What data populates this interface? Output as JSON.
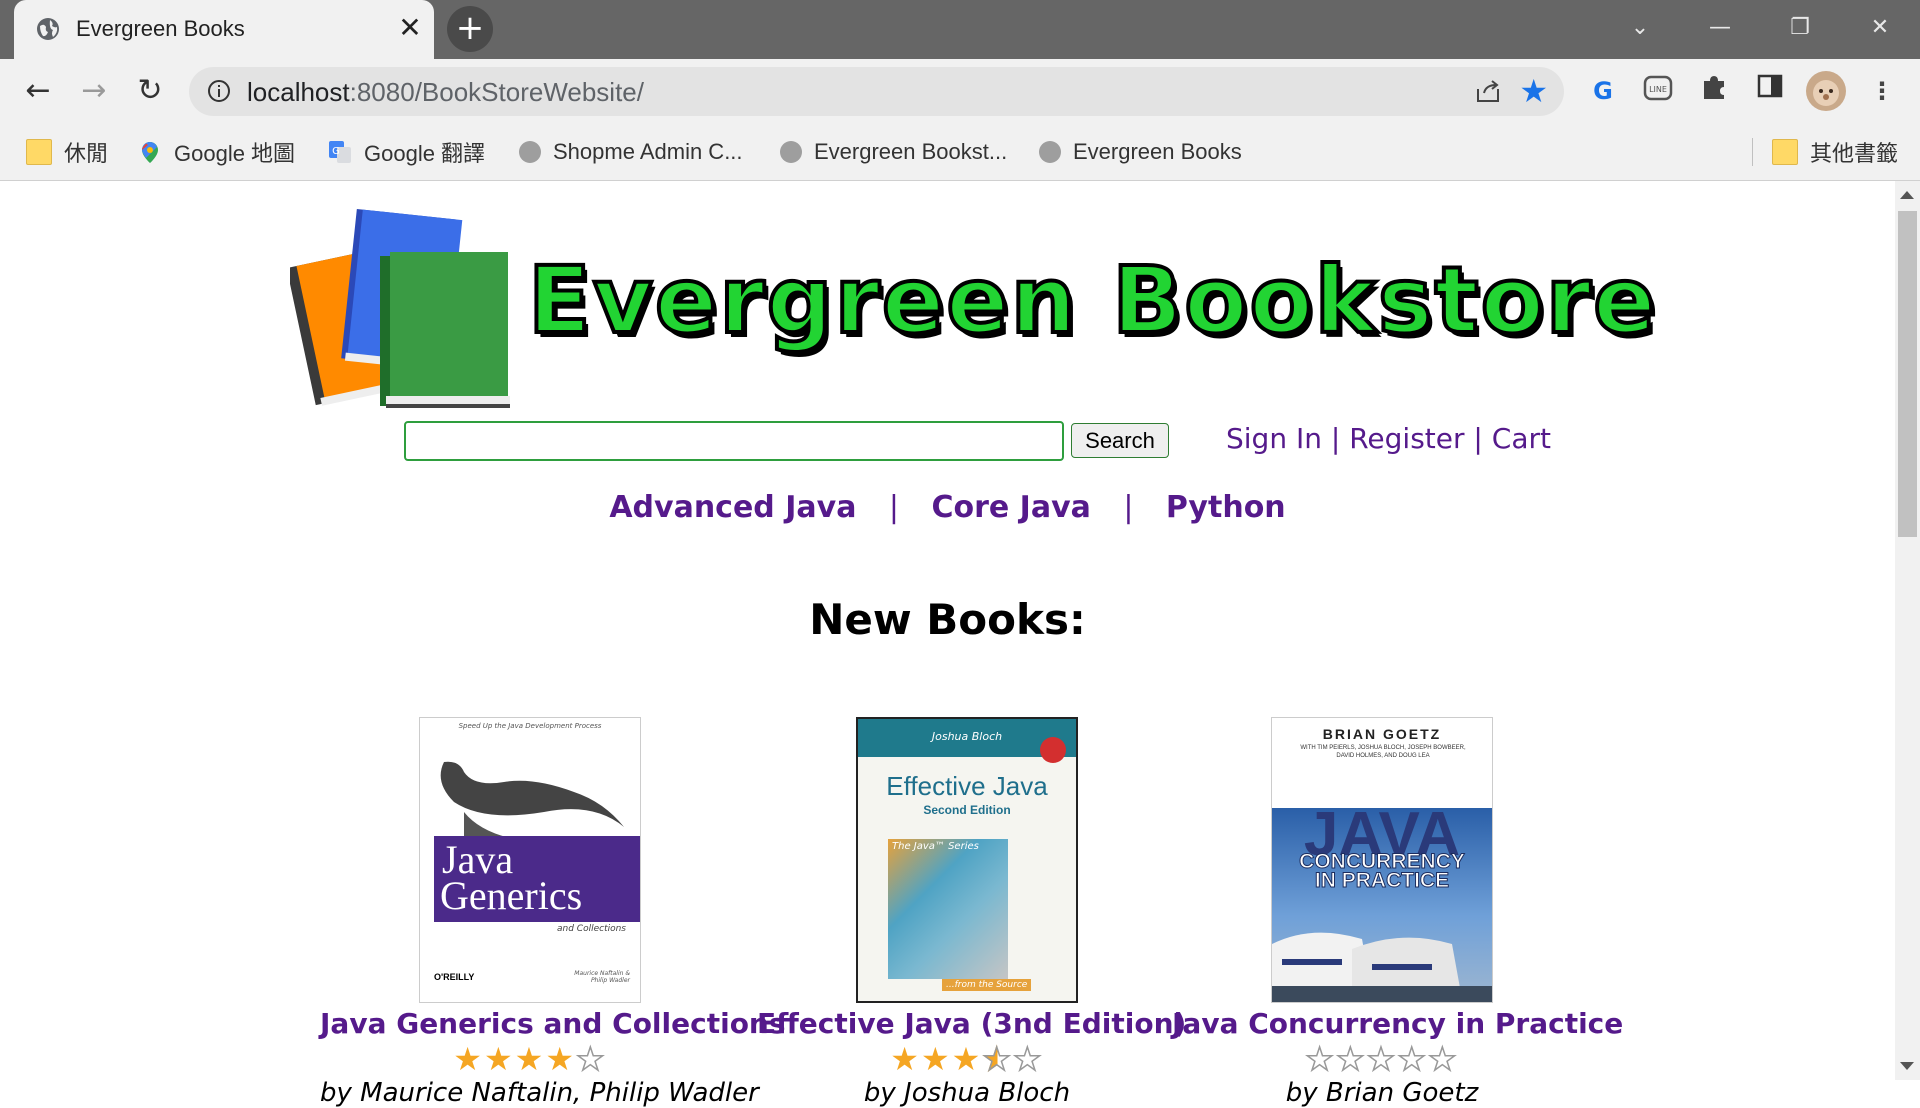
{
  "browser": {
    "tab_title": "Evergreen Books",
    "url_host": "localhost",
    "url_rest": ":8080/BookStoreWebsite/",
    "bookmarks": [
      {
        "label": "休閒",
        "icon": "folder-icon"
      },
      {
        "label": "Google 地圖",
        "icon": "google-maps-icon"
      },
      {
        "label": "Google 翻譯",
        "icon": "google-translate-icon"
      },
      {
        "label": "Shopme Admin C...",
        "icon": "globe-icon"
      },
      {
        "label": "Evergreen Bookst...",
        "icon": "globe-icon"
      },
      {
        "label": "Evergreen Books",
        "icon": "globe-icon"
      }
    ],
    "other_bookmarks": "其他書籤"
  },
  "header": {
    "logo_text": "Evergreen Bookstore",
    "search_button": "Search",
    "search_value": "",
    "sign_in": "Sign In",
    "register": "Register",
    "cart": "Cart",
    "separator": "|"
  },
  "categories": [
    "Advanced Java",
    "Core Java",
    "Python"
  ],
  "section_title": "New Books:",
  "books": [
    {
      "title": "Java Generics and Collections",
      "rating": 4,
      "author": "by Maurice Naftalin, Philip Wadler"
    },
    {
      "title": "Effective Java (3nd Edition)",
      "rating": 3.5,
      "author": "by Joshua Bloch"
    },
    {
      "title": "Java Concurrency in Practice",
      "rating": 0,
      "author": "by Brian Goetz"
    }
  ],
  "covers": {
    "generics": {
      "top": "Speed Up the Java Development Process",
      "line1": "Java",
      "line2": "Generics",
      "sub": "and Collections",
      "publisher": "O'REILLY",
      "authors": "Maurice Naftalin & Philip Wadler"
    },
    "effective": {
      "author": "Joshua Bloch",
      "title": "Effective Java",
      "edition": "Second Edition",
      "series": "The Java™ Series",
      "footer": "...from the Source"
    },
    "concurrency": {
      "author": "BRIAN GOETZ",
      "coauthors": "WITH TIM PEIERLS, JOSHUA BLOCH, JOSEPH BOWBEER, DAVID HOLMES, AND DOUG LEA",
      "line1": "JAVA",
      "line2": "CONCURRENCY",
      "line3": "IN PRACTICE"
    }
  }
}
